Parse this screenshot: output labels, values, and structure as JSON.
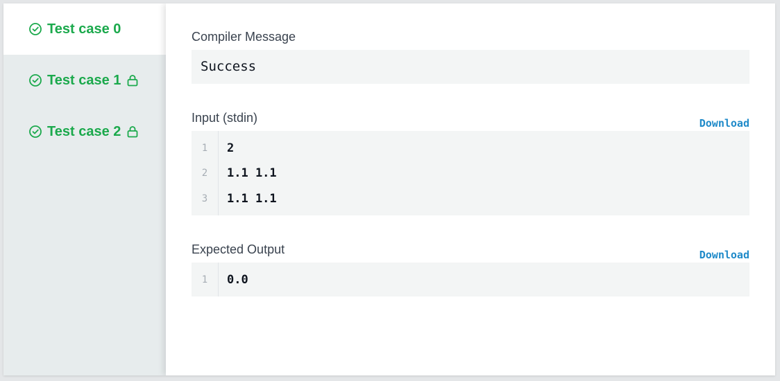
{
  "tabs": [
    {
      "label": "Test case 0",
      "locked": false,
      "active": true
    },
    {
      "label": "Test case 1",
      "locked": true,
      "active": false
    },
    {
      "label": "Test case 2",
      "locked": true,
      "active": false
    }
  ],
  "compiler": {
    "label": "Compiler Message",
    "message": "Success"
  },
  "input": {
    "label": "Input (stdin)",
    "download_label": "Download",
    "lines": [
      {
        "num": "1",
        "text": "2"
      },
      {
        "num": "2",
        "text": "1.1 1.1"
      },
      {
        "num": "3",
        "text": "1.1 1.1"
      }
    ]
  },
  "expected": {
    "label": "Expected Output",
    "download_label": "Download",
    "lines": [
      {
        "num": "1",
        "text": "0.0"
      }
    ]
  },
  "colors": {
    "success": "#1ba94c",
    "link": "#1f8ac9"
  }
}
